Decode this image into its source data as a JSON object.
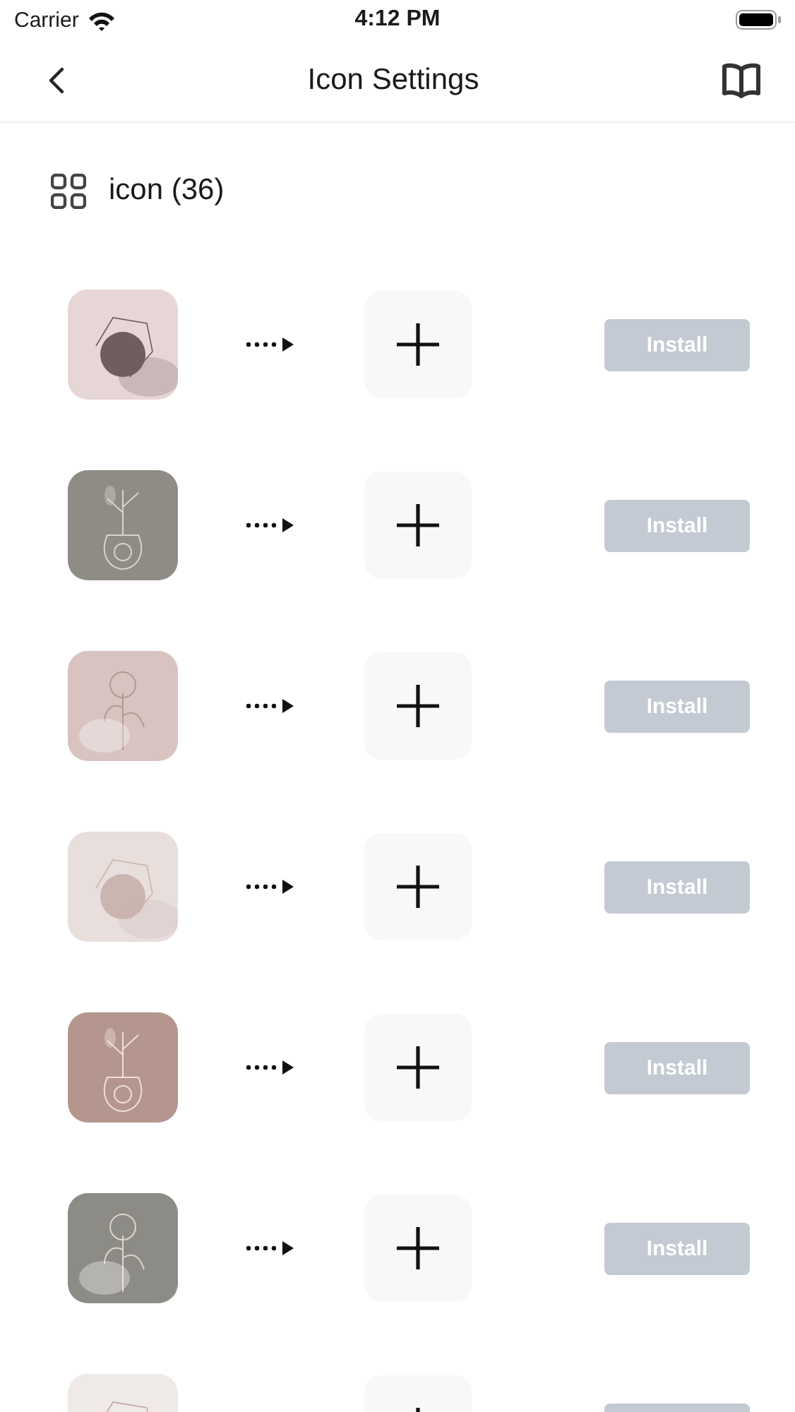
{
  "status_bar": {
    "carrier": "Carrier",
    "time": "4:12 PM"
  },
  "nav_bar": {
    "title": "Icon Settings"
  },
  "section": {
    "label": "icon (36)"
  },
  "rows": [
    {
      "kind": "picture",
      "install": {
        "label": "Install",
        "disabled": true
      }
    },
    {
      "kind": "picture",
      "install": {
        "label": "Install",
        "disabled": true
      }
    },
    {
      "kind": "picture",
      "install": {
        "label": "Install",
        "disabled": true
      }
    },
    {
      "kind": "picture",
      "install": {
        "label": "Install",
        "disabled": true
      }
    },
    {
      "kind": "picture",
      "install": {
        "label": "Install",
        "disabled": true
      }
    },
    {
      "kind": "picture",
      "install": {
        "label": "Install",
        "disabled": true
      }
    },
    {
      "kind": "picture",
      "arrow": false,
      "install": {
        "disabled": true
      }
    }
  ]
}
